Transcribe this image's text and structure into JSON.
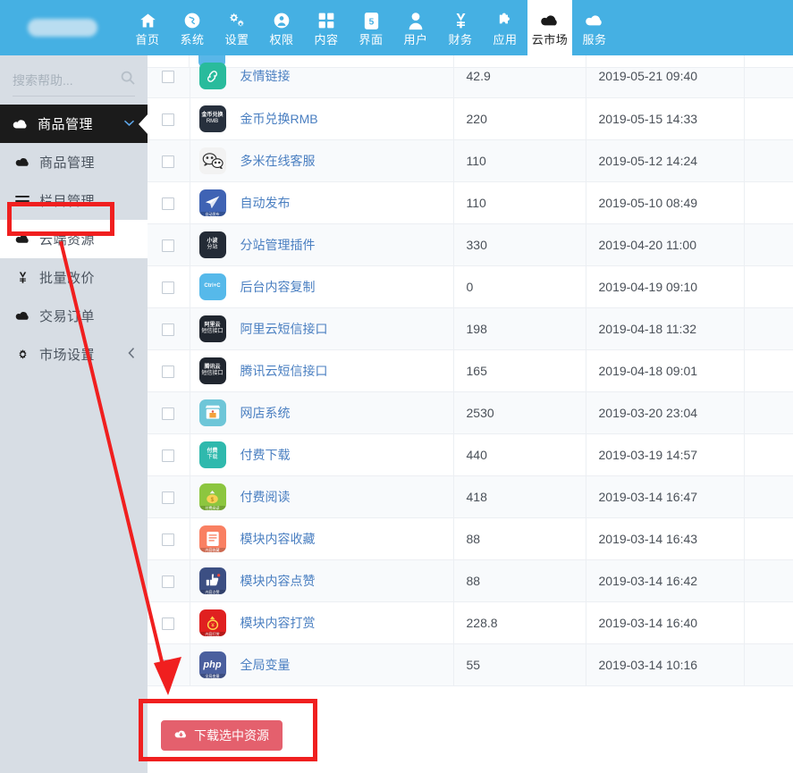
{
  "topnav": {
    "brand": "",
    "items": [
      {
        "label": "首页",
        "icon": "home-icon",
        "active": false
      },
      {
        "label": "系统",
        "icon": "globe-icon",
        "active": false
      },
      {
        "label": "设置",
        "icon": "gears-icon",
        "active": false
      },
      {
        "label": "权限",
        "icon": "user-circle-icon",
        "active": false
      },
      {
        "label": "内容",
        "icon": "grid-icon",
        "active": false
      },
      {
        "label": "界面",
        "icon": "html5-icon",
        "active": false
      },
      {
        "label": "用户",
        "icon": "user-icon",
        "active": false
      },
      {
        "label": "财务",
        "icon": "yen-icon",
        "active": false
      },
      {
        "label": "应用",
        "icon": "puzzle-icon",
        "active": false
      },
      {
        "label": "云市场",
        "icon": "cloud-icon",
        "active": true
      },
      {
        "label": "服务",
        "icon": "cloud-icon",
        "active": false
      }
    ]
  },
  "sidebar": {
    "search": {
      "value": "",
      "placeholder": "搜索帮助...",
      "icon": "search-icon"
    },
    "group": {
      "label": "商品管理",
      "icon": "cloud-icon",
      "chevron": "chevron-down-icon"
    },
    "items": [
      {
        "label": "商品管理",
        "icon": "cloud-icon",
        "highlight": false,
        "chevron": ""
      },
      {
        "label": "栏目管理",
        "icon": "list-icon",
        "highlight": false,
        "chevron": ""
      },
      {
        "label": "云端资源",
        "icon": "cloud-icon",
        "highlight": true,
        "chevron": ""
      },
      {
        "label": "批量改价",
        "icon": "yen-icon",
        "highlight": false,
        "chevron": ""
      },
      {
        "label": "交易订单",
        "icon": "cloud-icon",
        "highlight": false,
        "chevron": ""
      },
      {
        "label": "市场设置",
        "icon": "gear-icon",
        "highlight": false,
        "chevron": "chevron-left-icon"
      }
    ]
  },
  "table": {
    "rows": [
      {
        "name": "友情链接",
        "price": "42.9",
        "date": "2019-05-21 09:40",
        "icon_text1": "",
        "icon_text2": "",
        "icon_bg": "#29bb9c",
        "icon_kind": "link"
      },
      {
        "name": "金币兑换RMB",
        "price": "220",
        "date": "2019-05-15 14:33",
        "icon_text1": "金币兑换",
        "icon_text2": "RMB",
        "icon_bg": "#27303d",
        "icon_kind": "text"
      },
      {
        "name": "多米在线客服",
        "price": "110",
        "date": "2019-05-12 14:24",
        "icon_text1": "",
        "icon_text2": "",
        "icon_bg": "#f2f2f2",
        "icon_kind": "wechat"
      },
      {
        "name": "自动发布",
        "price": "110",
        "date": "2019-05-10 08:49",
        "icon_text1": "",
        "icon_text2": "自动发布",
        "icon_bg": "#3f63b4",
        "icon_kind": "plane"
      },
      {
        "name": "分站管理插件",
        "price": "330",
        "date": "2019-04-20 11:00",
        "icon_text1": "小波",
        "icon_text2": "分站",
        "icon_bg": "#242b36",
        "icon_kind": "text"
      },
      {
        "name": "后台内容复制",
        "price": "0",
        "date": "2019-04-19 09:10",
        "icon_text1": "Ctrl+C",
        "icon_text2": "",
        "icon_bg": "#56b9ea",
        "icon_kind": "text"
      },
      {
        "name": "阿里云短信接口",
        "price": "198",
        "date": "2019-04-18 11:32",
        "icon_text1": "阿里云",
        "icon_text2": "短信接口",
        "icon_bg": "#20262f",
        "icon_kind": "text"
      },
      {
        "name": "腾讯云短信接口",
        "price": "165",
        "date": "2019-04-18 09:01",
        "icon_text1": "腾讯云",
        "icon_text2": "短信接口",
        "icon_bg": "#20262f",
        "icon_kind": "text"
      },
      {
        "name": "网店系统",
        "price": "2530",
        "date": "2019-03-20 23:04",
        "icon_text1": "",
        "icon_text2": "",
        "icon_bg": "#6ec6d8",
        "icon_kind": "shop"
      },
      {
        "name": "付费下载",
        "price": "440",
        "date": "2019-03-19 14:57",
        "icon_text1": "付费",
        "icon_text2": "下载",
        "icon_bg": "#2fb9ad",
        "icon_kind": "text"
      },
      {
        "name": "付费阅读",
        "price": "418",
        "date": "2019-03-14 16:47",
        "icon_text1": "",
        "icon_text2": "付费阅读",
        "icon_bg": "#8cc63f",
        "icon_kind": "money"
      },
      {
        "name": "模块内容收藏",
        "price": "88",
        "date": "2019-03-14 16:43",
        "icon_text1": "",
        "icon_text2": "内容收藏",
        "icon_bg": "#f98062",
        "icon_kind": "doc"
      },
      {
        "name": "模块内容点赞",
        "price": "88",
        "date": "2019-03-14 16:42",
        "icon_text1": "",
        "icon_text2": "内容点赞",
        "icon_bg": "#3c4f83",
        "icon_kind": "thumb"
      },
      {
        "name": "模块内容打赏",
        "price": "228.8",
        "date": "2019-03-14 16:40",
        "icon_text1": "",
        "icon_text2": "内容打赏",
        "icon_bg": "#e02020",
        "icon_kind": "reward"
      },
      {
        "name": "全局变量",
        "price": "55",
        "date": "2019-03-14 10:16",
        "icon_text1": "php",
        "icon_text2": "全局变量",
        "icon_bg": "#4a5f9e",
        "icon_kind": "php"
      }
    ]
  },
  "footer": {
    "download_label": "下载选中资源",
    "download_icon": "cloud-download-icon"
  },
  "colors": {
    "nav_blue": "#45b0e3",
    "sidebar_gray": "#d7dde4",
    "active_dark": "#1b1b1b",
    "link_blue": "#4a7fc1",
    "danger_red": "#e4606d",
    "annotation_red": "#f01f1f"
  }
}
